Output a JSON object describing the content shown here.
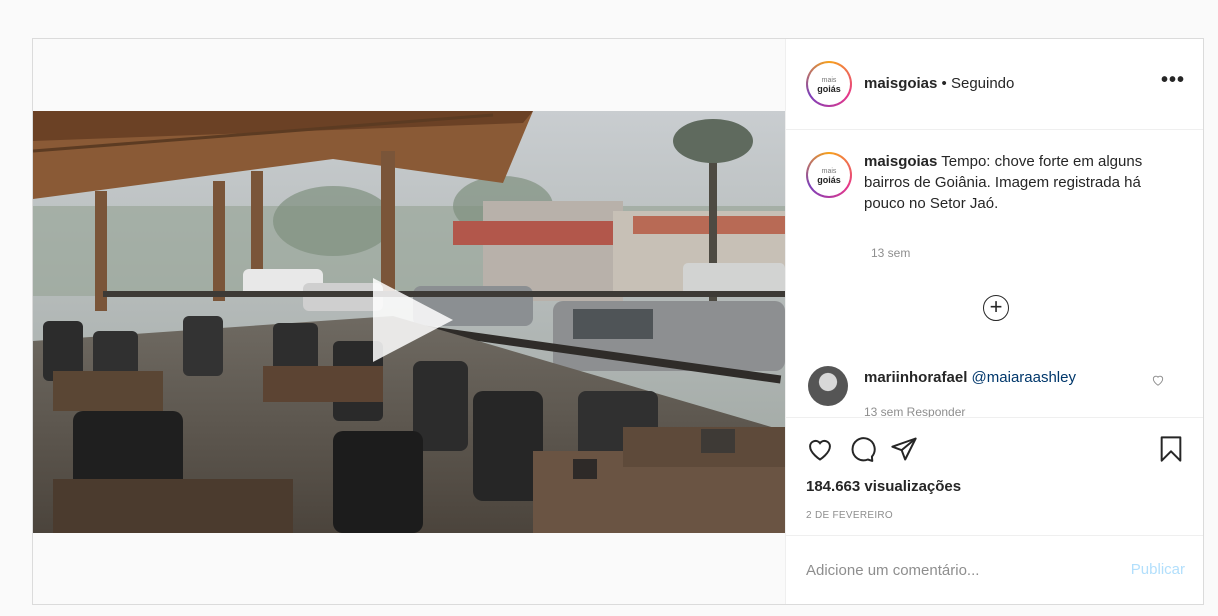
{
  "post": {
    "username": "maisgoias",
    "follow_status": "• Seguindo",
    "more_label": "•••",
    "avatar_text_top": "mais",
    "avatar_text_bottom": "goiás",
    "caption_user": "maisgoias",
    "caption_text": " Tempo: chove forte em alguns bairros de Goiânia. Imagem registrada há pouco no Setor Jaó.",
    "caption_time": "13 sem",
    "load_more_label": "+",
    "comments": [
      {
        "user": "mariinhorafael",
        "mention": "@maiaraashley",
        "meta": "13 sem   Responder"
      }
    ],
    "views": "184.663 visualizações",
    "date": "2 DE FEVEREIRO",
    "comment_placeholder": "Adicione um comentário...",
    "publish_label": "Publicar"
  },
  "colors": {
    "link": "#00376b",
    "publish_disabled": "#b2dffc",
    "meta": "#8e8e8e"
  },
  "icons": {
    "more": "more-icon",
    "play": "play-icon",
    "like": "heart-icon",
    "comment": "comment-icon",
    "share": "share-icon",
    "save": "bookmark-icon",
    "load_more": "plus-circle-icon"
  }
}
